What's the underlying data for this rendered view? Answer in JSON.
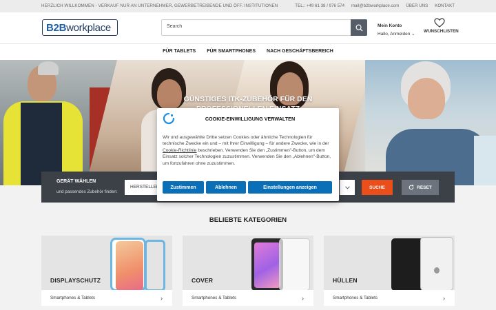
{
  "topbar": {
    "welcome": "HERZLICH WILLKOMMEN - VERKAUF NUR AN UNTERNEHMER, GEWERBETREIBENDE UND ÖFF. INSTITUTIONEN",
    "phone": "TEL.: +49 61 38 / 976 574",
    "email": "mail@b2bworkplace.com",
    "about": "ÜBER UNS",
    "contact": "KONTAKT"
  },
  "header": {
    "logo_b2b": "B2B",
    "logo_workplace": "workplace",
    "search_placeholder": "Search",
    "account_title": "Mein Konto",
    "account_sub": "Hallo, Anmelden",
    "wishlist": "WUNSCHLISTEN"
  },
  "nav": [
    "FÜR TABLETS",
    "FÜR SMARTPHONES",
    "NACH GESCHÄFTSBEREICH"
  ],
  "hero": {
    "headline": "GÜNSTIGES ITK-ZUBEHÖR FÜR DEN PROFESSIONELLEN EINSATZ"
  },
  "finder": {
    "label": "GERÄT WÄHLEN",
    "sub": "und passendes Zubehör finden:",
    "select": "HERSTELLER",
    "search_btn": "SUCHE",
    "reset_btn": "RESET"
  },
  "section": {
    "title": "BELIEBTE KATEGORIEN"
  },
  "cards": [
    {
      "name": "DISPLAYSCHUTZ",
      "sub": "Smartphones & Tablets"
    },
    {
      "name": "COVER",
      "sub": "Smartphones & Tablets"
    },
    {
      "name": "HÜLLEN",
      "sub": "Smartphones & Tablets"
    }
  ],
  "cookie": {
    "title": "COOKIE-EINWILLIGUNG VERWALTEN",
    "text_before": "Wir und ausgewählte Dritte setzen Cookies oder ähnliche Technologien für technische Zwecke ein und – mit Ihrer Einwilligung – für andere Zwecke, wie in der ",
    "link": "Cookie-Richtlinie",
    "text_after": " beschrieben. Verwenden Sie den „Zustimmen\"-Button, um dem Einsatz solcher Technologien zuzustimmen. Verwenden Sie den „Ablehnen\"-Button, um fortzufahren ohne zuzustimmen.",
    "accept": "Zustimmen",
    "reject": "Ablehnen",
    "settings": "Einstellungen anzeigen"
  }
}
